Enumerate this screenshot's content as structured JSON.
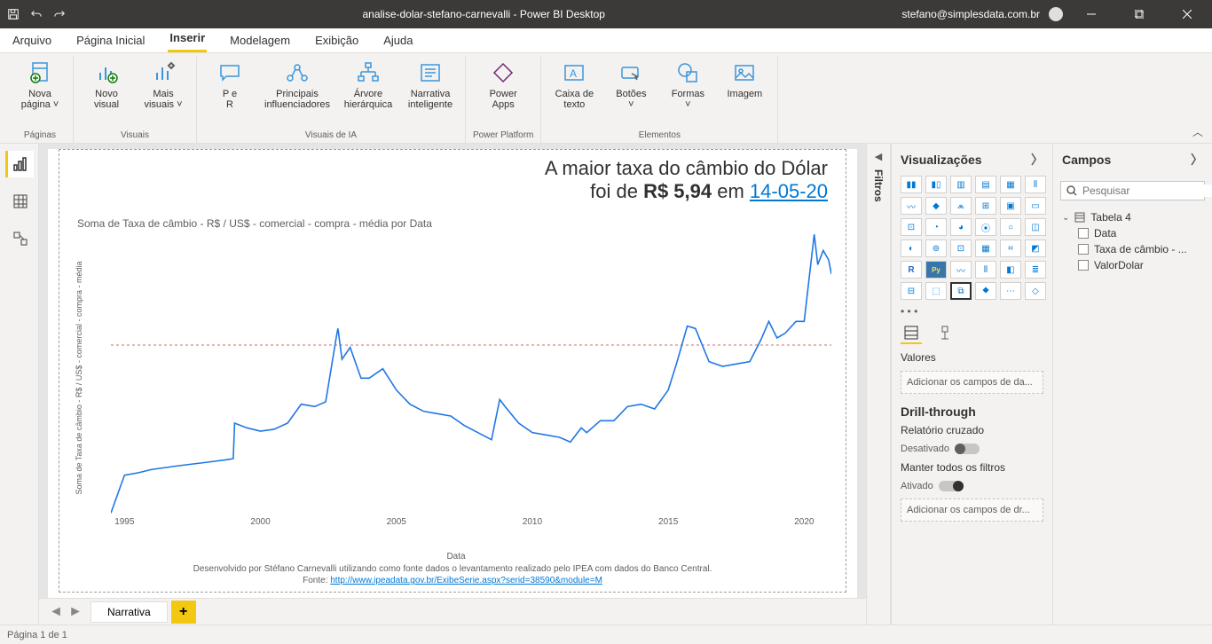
{
  "titlebar": {
    "doc": "analise-dolar-stefano-carnevalli - Power BI Desktop",
    "user": "stefano@simplesdata.com.br"
  },
  "menu": {
    "arquivo": "Arquivo",
    "pagina": "Página Inicial",
    "inserir": "Inserir",
    "modelagem": "Modelagem",
    "exibicao": "Exibição",
    "ajuda": "Ajuda"
  },
  "ribbon": {
    "groups": {
      "paginas": "Páginas",
      "visuais": "Visuais",
      "visuais_ia": "Visuais de IA",
      "power_platform": "Power Platform",
      "elementos": "Elementos"
    },
    "btns": {
      "nova_pagina": "Nova\npágina ˅",
      "novo_visual": "Novo\nvisual",
      "mais_visuais": "Mais\nvisuais ˅",
      "p_e_r": "P e\nR",
      "principais": "Principais\ninfluenciadores",
      "arvore": "Árvore\nhierárquica",
      "narrativa": "Narrativa\ninteligente",
      "power_apps": "Power\nApps",
      "caixa_texto": "Caixa de\ntexto",
      "botoes": "Botões\n˅",
      "formas": "Formas\n˅",
      "imagem": "Imagem"
    }
  },
  "leftrail": {
    "report": "",
    "data": "",
    "model": ""
  },
  "filters_label": "Filtros",
  "tabs": {
    "narrativa": "Narrativa"
  },
  "status": "Página 1 de 1",
  "viz_panel": {
    "title": "Visualizações",
    "valores": "Valores",
    "add_valores": "Adicionar os campos de da...",
    "drill": "Drill-through",
    "rel_cruz": "Relatório cruzado",
    "desativado": "Desativado",
    "manter": "Manter todos os filtros",
    "ativado": "Ativado",
    "add_drill": "Adicionar os campos de dr..."
  },
  "fields_panel": {
    "title": "Campos",
    "search_ph": "Pesquisar",
    "table": "Tabela 4",
    "f1": "Data",
    "f2": "Taxa de câmbio - ...",
    "f3": "ValorDolar"
  },
  "report": {
    "headline1": "A maior taxa do câmbio do Dólar",
    "headline2a": "foi de ",
    "headline2b": "R$ 5,94",
    "headline2c": " em ",
    "headline2d": "14-05-20",
    "chart_title": "Soma de Taxa de câmbio - R$ / US$ - comercial - compra - média por Data",
    "yaxis_label": "Soma de Taxa de câmbio - R$ / US$ - comercial - compra - média",
    "xaxis_label": "Data",
    "footer1": "Desenvolvido por Stéfano Carnevalli utilizando como fonte dados o levantamento realizado pelo IPEA com dados do Banco Central.",
    "footer2a": "Fonte: ",
    "footer2b": "http://www.ipeadata.gov.br/ExibeSerie.aspx?serid=38590&module=M"
  },
  "chart_data": {
    "type": "line",
    "xlabel": "Data",
    "ylabel": "Soma de Taxa de câmbio - R$ / US$ - comercial - compra - média",
    "ylim": [
      0,
      6
    ],
    "yticks": [
      "R$ 0",
      "R$ 1",
      "R$ 2",
      "R$ 3",
      "R$ 4",
      "R$ 5",
      "R$ 6"
    ],
    "xticks": [
      "1995",
      "2000",
      "2005",
      "2010",
      "2015",
      "2020"
    ],
    "reference_line": 3.6,
    "series": [
      {
        "name": "Taxa de câmbio",
        "color": "#1f77e4",
        "points": [
          [
            1994.5,
            0.05
          ],
          [
            1995,
            0.85
          ],
          [
            1995.5,
            0.9
          ],
          [
            1996,
            0.97
          ],
          [
            1997,
            1.05
          ],
          [
            1998,
            1.12
          ],
          [
            1998.8,
            1.18
          ],
          [
            1999,
            1.2
          ],
          [
            1999.05,
            1.95
          ],
          [
            1999.5,
            1.85
          ],
          [
            2000,
            1.78
          ],
          [
            2000.5,
            1.82
          ],
          [
            2001,
            1.95
          ],
          [
            2001.5,
            2.35
          ],
          [
            2002,
            2.3
          ],
          [
            2002.4,
            2.4
          ],
          [
            2002.8,
            3.8
          ],
          [
            2002.85,
            3.95
          ],
          [
            2003,
            3.3
          ],
          [
            2003.3,
            3.55
          ],
          [
            2003.7,
            2.9
          ],
          [
            2004,
            2.9
          ],
          [
            2004.5,
            3.1
          ],
          [
            2005,
            2.65
          ],
          [
            2005.5,
            2.35
          ],
          [
            2006,
            2.2
          ],
          [
            2006.5,
            2.15
          ],
          [
            2007,
            2.1
          ],
          [
            2007.5,
            1.9
          ],
          [
            2008,
            1.75
          ],
          [
            2008.5,
            1.6
          ],
          [
            2008.8,
            2.45
          ],
          [
            2009,
            2.3
          ],
          [
            2009.5,
            1.95
          ],
          [
            2010,
            1.75
          ],
          [
            2010.5,
            1.7
          ],
          [
            2011,
            1.65
          ],
          [
            2011.4,
            1.55
          ],
          [
            2011.8,
            1.85
          ],
          [
            2012,
            1.75
          ],
          [
            2012.5,
            2.0
          ],
          [
            2013,
            2.0
          ],
          [
            2013.5,
            2.3
          ],
          [
            2014,
            2.35
          ],
          [
            2014.5,
            2.25
          ],
          [
            2015,
            2.65
          ],
          [
            2015.3,
            3.2
          ],
          [
            2015.7,
            4.0
          ],
          [
            2016,
            3.95
          ],
          [
            2016.5,
            3.25
          ],
          [
            2017,
            3.15
          ],
          [
            2017.5,
            3.2
          ],
          [
            2018,
            3.25
          ],
          [
            2018.4,
            3.7
          ],
          [
            2018.7,
            4.1
          ],
          [
            2019,
            3.75
          ],
          [
            2019.3,
            3.85
          ],
          [
            2019.7,
            4.1
          ],
          [
            2020,
            4.1
          ],
          [
            2020.2,
            5.1
          ],
          [
            2020.37,
            5.94
          ],
          [
            2020.5,
            5.3
          ],
          [
            2020.7,
            5.6
          ],
          [
            2020.9,
            5.4
          ],
          [
            2021,
            5.1
          ]
        ]
      }
    ]
  }
}
